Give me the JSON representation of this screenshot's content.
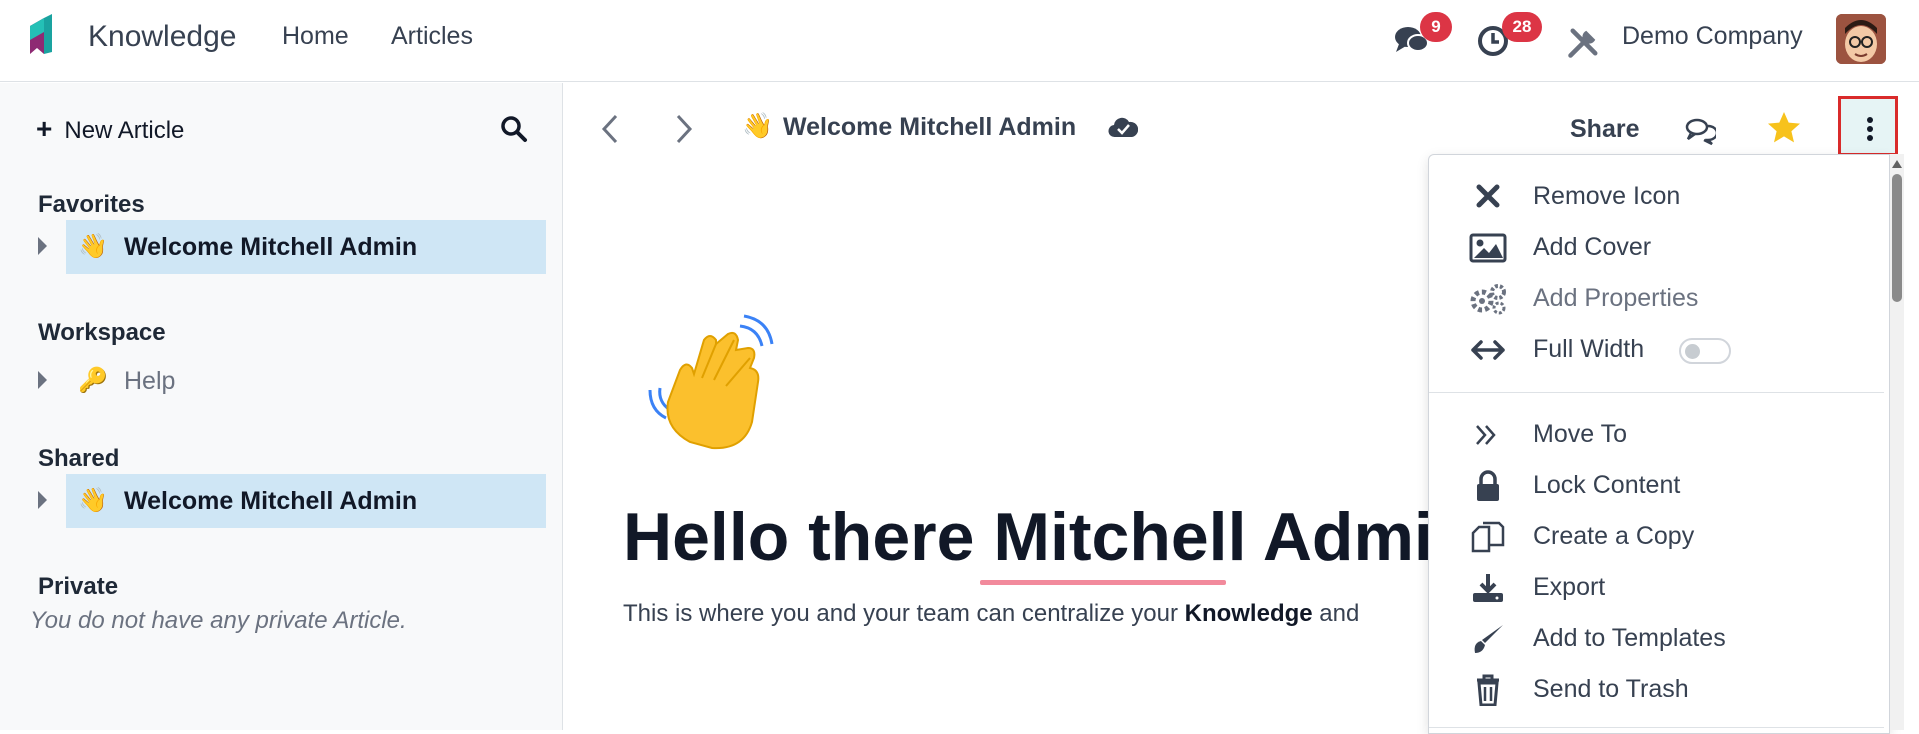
{
  "navbar": {
    "app_name": "Knowledge",
    "menu": {
      "home": "Home",
      "articles": "Articles"
    },
    "messages_badge": "9",
    "activities_badge": "28",
    "company": "Demo Company",
    "icons": {
      "messages": "chat-icon",
      "activities": "clock-icon",
      "debug": "tools-icon",
      "avatar": "user-avatar"
    }
  },
  "sidebar": {
    "new_article_label": "New Article",
    "sections": {
      "favorites": {
        "title": "Favorites",
        "items": [
          {
            "emoji": "👋",
            "label": "Welcome Mitchell Admin"
          }
        ]
      },
      "workspace": {
        "title": "Workspace",
        "items": [
          {
            "emoji": "🔑",
            "label": "Help"
          }
        ]
      },
      "shared": {
        "title": "Shared",
        "items": [
          {
            "emoji": "👋",
            "label": "Welcome Mitchell Admin"
          }
        ]
      },
      "private": {
        "title": "Private",
        "empty_text": "You do not have any private Article."
      }
    }
  },
  "toolbar": {
    "breadcrumb_emoji": "👋",
    "breadcrumb_title": "Welcome Mitchell Admin",
    "share_label": "Share",
    "favorite_color": "#f7c21c"
  },
  "article": {
    "heading": "Hello there Mitchell Admin",
    "body_prefix": "This is where you and your team can centralize your ",
    "body_bold": "Knowledge",
    "body_suffix": " and"
  },
  "dropdown": {
    "group1": [
      {
        "icon": "close-icon",
        "label": "Remove Icon"
      },
      {
        "icon": "image-icon",
        "label": "Add Cover"
      },
      {
        "icon": "gears-icon",
        "label": "Add Properties",
        "disabled": true
      },
      {
        "icon": "arrows-horizontal-icon",
        "label": "Full Width",
        "toggle": false
      }
    ],
    "group2": [
      {
        "icon": "double-chevron-right-icon",
        "label": "Move To"
      },
      {
        "icon": "lock-icon",
        "label": "Lock Content"
      },
      {
        "icon": "copy-icon",
        "label": "Create a Copy"
      },
      {
        "icon": "download-icon",
        "label": "Export"
      },
      {
        "icon": "paintbrush-icon",
        "label": "Add to Templates"
      },
      {
        "icon": "trash-icon",
        "label": "Send to Trash"
      }
    ]
  },
  "colors": {
    "accent": "#017e84",
    "active_row": "#cfe6f5",
    "badge": "#dc3545",
    "highlight_border": "#d92b2b"
  }
}
